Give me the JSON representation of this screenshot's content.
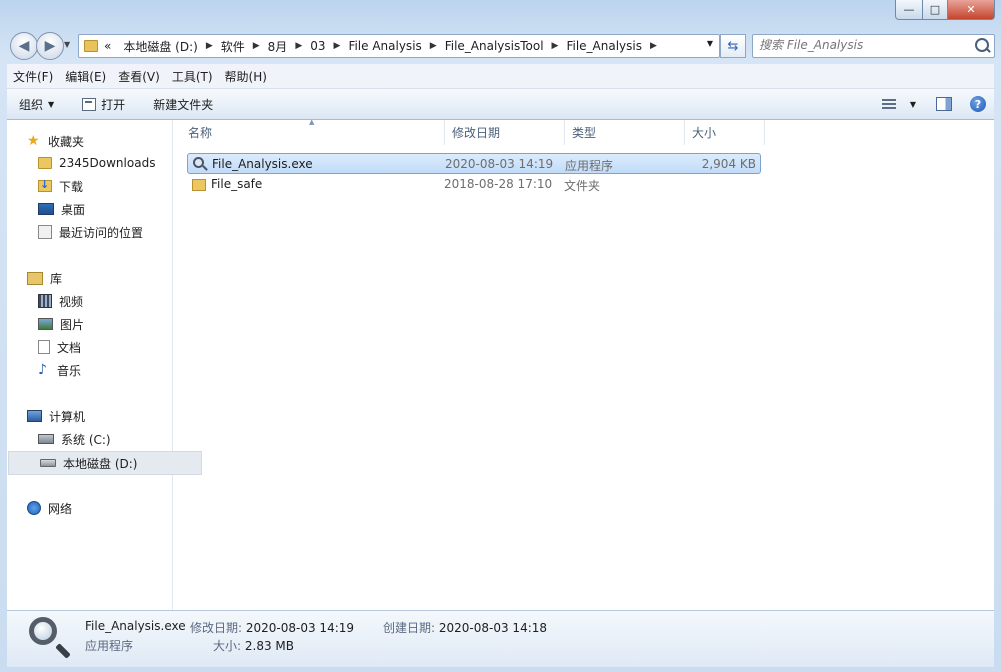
{
  "window": {
    "minimize": "—",
    "maximize": "□",
    "close": "✕"
  },
  "address": {
    "overflow": "«",
    "crumbs": [
      "本地磁盘 (D:)",
      "软件",
      "8月",
      "03",
      "File Analysis",
      "File_AnalysisTool",
      "File_Analysis"
    ]
  },
  "search": {
    "placeholder": "搜索 File_Analysis"
  },
  "menu": [
    "文件(F)",
    "编辑(E)",
    "查看(V)",
    "工具(T)",
    "帮助(H)"
  ],
  "toolbar": {
    "organize": "组织",
    "open": "打开",
    "new_folder": "新建文件夹"
  },
  "nav": {
    "favorites": "收藏夹",
    "fav_items": [
      "2345Downloads",
      "下载",
      "桌面",
      "最近访问的位置"
    ],
    "library": "库",
    "lib_items": [
      "视频",
      "图片",
      "文档",
      "音乐"
    ],
    "computer": "计算机",
    "drives": [
      "系统 (C:)",
      "本地磁盘 (D:)"
    ],
    "network": "网络"
  },
  "columns": {
    "name": "名称",
    "date": "修改日期",
    "type": "类型",
    "size": "大小"
  },
  "files": [
    {
      "name": "File_Analysis.exe",
      "date": "2020-08-03 14:19",
      "type": "应用程序",
      "size": "2,904 KB"
    },
    {
      "name": "File_safe",
      "date": "2018-08-28 17:10",
      "type": "文件夹",
      "size": ""
    }
  ],
  "details": {
    "filename": "File_Analysis.exe",
    "filetype": "应用程序",
    "modified_label": "修改日期:",
    "modified": "2020-08-03 14:19",
    "created_label": "创建日期:",
    "created": "2020-08-03 14:18",
    "size_label": "大小:",
    "size": "2.83 MB"
  }
}
